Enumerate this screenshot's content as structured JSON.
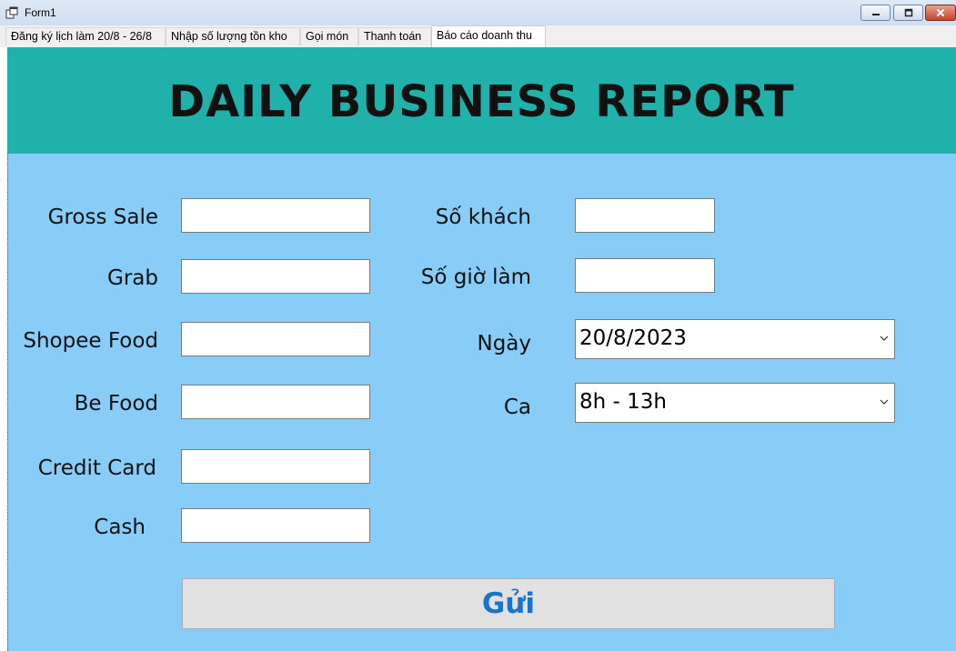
{
  "window": {
    "title": "Form1"
  },
  "tabs": [
    {
      "label": "Đăng ký lịch làm 20/8 - 26/8"
    },
    {
      "label": "Nhập số lượng tồn kho"
    },
    {
      "label": "Gọi món"
    },
    {
      "label": "Thanh toán"
    },
    {
      "label": "Báo cáo doanh thu"
    }
  ],
  "active_tab": "Báo cáo doanh thu",
  "banner": {
    "title": "DAILY BUSINESS REPORT",
    "bg": "#20b2aa"
  },
  "form": {
    "left_fields": [
      {
        "label": "Gross Sale",
        "value": ""
      },
      {
        "label": "Grab",
        "value": ""
      },
      {
        "label": "Shopee Food",
        "value": ""
      },
      {
        "label": "Be Food",
        "value": ""
      },
      {
        "label": "Credit Card",
        "value": ""
      },
      {
        "label": "Cash",
        "value": ""
      }
    ],
    "right_fields": [
      {
        "label": "Số khách",
        "value": ""
      },
      {
        "label": "Số giờ làm",
        "value": ""
      }
    ],
    "date": {
      "label": "Ngày",
      "value": "20/8/2023"
    },
    "shift": {
      "label": "Ca",
      "value": "8h - 13h"
    },
    "submit_label": "Gửi"
  },
  "colors": {
    "panel": "#87cdf7",
    "accent": "#1874cd"
  },
  "icons": {
    "window_icon": "app-form-icon",
    "dropdown": "chevron-down-icon"
  }
}
